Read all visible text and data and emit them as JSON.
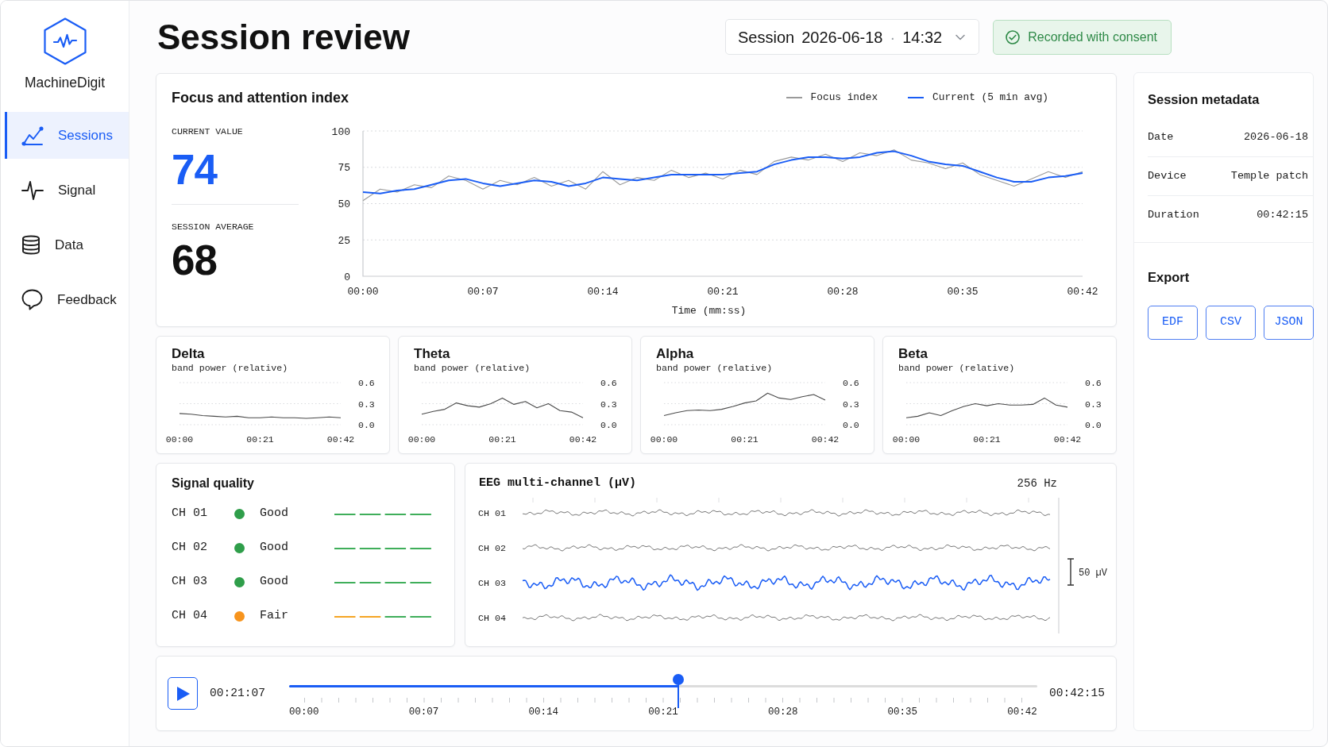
{
  "sidebar": {
    "brand": "MachineDigit",
    "items": [
      {
        "label": "Sessions",
        "selected": true
      },
      {
        "label": "Signal",
        "selected": false
      },
      {
        "label": "Data",
        "selected": false
      },
      {
        "label": "Feedback",
        "selected": false
      }
    ]
  },
  "header": {
    "title": "Session review",
    "session_picker": {
      "label": "Session",
      "date": "2026-06-18",
      "separator": "·",
      "time": "14:32"
    },
    "consent_badge": "Recorded with consent"
  },
  "focus": {
    "title": "Focus and attention index",
    "stats": [
      {
        "kind": "current",
        "label": "CURRENT VALUE",
        "value": "74"
      },
      {
        "kind": "average",
        "label": "SESSION AVERAGE",
        "value": "68"
      }
    ],
    "chart_data": {
      "type": "line",
      "xlabel": "Time (mm:ss)",
      "grid": true,
      "x": [
        0,
        1,
        2,
        3,
        4,
        5,
        6,
        7,
        8,
        9,
        10,
        11,
        12,
        13,
        14,
        15,
        16,
        17,
        18,
        19,
        20,
        21,
        22,
        23,
        24,
        25,
        26,
        27,
        28,
        29,
        30,
        31,
        32,
        33,
        34,
        35,
        36,
        37,
        38,
        39,
        40,
        41,
        42
      ],
      "xlim": [
        0,
        42
      ],
      "ylim": [
        0,
        100
      ],
      "xticks": [
        {
          "value": 0,
          "label": "00:00"
        },
        {
          "value": 7,
          "label": "00:07"
        },
        {
          "value": 14,
          "label": "00:14"
        },
        {
          "value": 21,
          "label": "00:21"
        },
        {
          "value": 28,
          "label": "00:28"
        },
        {
          "value": 35,
          "label": "00:35"
        },
        {
          "value": 42,
          "label": "00:42"
        }
      ],
      "yticks": [
        0,
        25,
        50,
        75,
        100
      ],
      "series": [
        {
          "name": "Focus index",
          "color": "#9a9a9a",
          "values": [
            52,
            60,
            58,
            63,
            61,
            69,
            66,
            60,
            66,
            63,
            68,
            62,
            66,
            60,
            72,
            63,
            68,
            66,
            73,
            68,
            71,
            67,
            73,
            70,
            79,
            82,
            80,
            84,
            79,
            85,
            83,
            87,
            80,
            78,
            74,
            78,
            70,
            66,
            62,
            67,
            72,
            68,
            72
          ]
        },
        {
          "name": "Current (5 min avg)",
          "color": "#1a5df5",
          "values": [
            58,
            57,
            59,
            60,
            63,
            66,
            67,
            64,
            62,
            64,
            66,
            65,
            62,
            64,
            68,
            67,
            66,
            68,
            70,
            70,
            70,
            70,
            71,
            72,
            77,
            80,
            82,
            82,
            81,
            82,
            85,
            86,
            83,
            79,
            77,
            76,
            72,
            68,
            65,
            65,
            68,
            69,
            71
          ]
        }
      ]
    }
  },
  "bands": [
    {
      "title": "Delta",
      "subtitle": "band power (relative)",
      "chart_data": {
        "type": "line",
        "grid": true,
        "x": [
          0,
          3,
          6,
          9,
          12,
          15,
          18,
          21,
          24,
          27,
          30,
          33,
          36,
          39,
          42
        ],
        "xlim": [
          0,
          42
        ],
        "ylim": [
          0,
          0.6
        ],
        "xticks": [
          {
            "value": 0,
            "label": "00:00"
          },
          {
            "value": 21,
            "label": "00:21"
          },
          {
            "value": 42,
            "label": "00:42"
          }
        ],
        "yticks": [
          {
            "value": 0,
            "label": "0.0"
          },
          {
            "value": 0.3,
            "label": "0.3"
          },
          {
            "value": 0.6,
            "label": "0.6"
          }
        ],
        "series": [
          {
            "values": [
              0.16,
              0.15,
              0.13,
              0.12,
              0.11,
              0.12,
              0.1,
              0.1,
              0.11,
              0.1,
              0.1,
              0.09,
              0.1,
              0.11,
              0.1
            ]
          }
        ]
      }
    },
    {
      "title": "Theta",
      "subtitle": "band power (relative)",
      "chart_data": {
        "type": "line",
        "grid": true,
        "x": [
          0,
          3,
          6,
          9,
          12,
          15,
          18,
          21,
          24,
          27,
          30,
          33,
          36,
          39,
          42
        ],
        "xlim": [
          0,
          42
        ],
        "ylim": [
          0,
          0.6
        ],
        "xticks": [
          {
            "value": 0,
            "label": "00:00"
          },
          {
            "value": 21,
            "label": "00:21"
          },
          {
            "value": 42,
            "label": "00:42"
          }
        ],
        "yticks": [
          {
            "value": 0,
            "label": "0.0"
          },
          {
            "value": 0.3,
            "label": "0.3"
          },
          {
            "value": 0.6,
            "label": "0.6"
          }
        ],
        "series": [
          {
            "values": [
              0.15,
              0.19,
              0.22,
              0.31,
              0.27,
              0.25,
              0.3,
              0.38,
              0.29,
              0.33,
              0.24,
              0.3,
              0.2,
              0.18,
              0.1
            ]
          }
        ]
      }
    },
    {
      "title": "Alpha",
      "subtitle": "band power (relative)",
      "chart_data": {
        "type": "line",
        "grid": true,
        "x": [
          0,
          3,
          6,
          9,
          12,
          15,
          18,
          21,
          24,
          27,
          30,
          33,
          36,
          39,
          42
        ],
        "xlim": [
          0,
          42
        ],
        "ylim": [
          0,
          0.6
        ],
        "xticks": [
          {
            "value": 0,
            "label": "00:00"
          },
          {
            "value": 21,
            "label": "00:21"
          },
          {
            "value": 42,
            "label": "00:42"
          }
        ],
        "yticks": [
          {
            "value": 0,
            "label": "0.0"
          },
          {
            "value": 0.3,
            "label": "0.3"
          },
          {
            "value": 0.6,
            "label": "0.6"
          }
        ],
        "series": [
          {
            "values": [
              0.13,
              0.17,
              0.2,
              0.21,
              0.2,
              0.22,
              0.26,
              0.31,
              0.34,
              0.45,
              0.38,
              0.36,
              0.4,
              0.43,
              0.35
            ]
          }
        ]
      }
    },
    {
      "title": "Beta",
      "subtitle": "band power (relative)",
      "chart_data": {
        "type": "line",
        "grid": true,
        "x": [
          0,
          3,
          6,
          9,
          12,
          15,
          18,
          21,
          24,
          27,
          30,
          33,
          36,
          39,
          42
        ],
        "xlim": [
          0,
          42
        ],
        "ylim": [
          0,
          0.6
        ],
        "xticks": [
          {
            "value": 0,
            "label": "00:00"
          },
          {
            "value": 21,
            "label": "00:21"
          },
          {
            "value": 42,
            "label": "00:42"
          }
        ],
        "yticks": [
          {
            "value": 0,
            "label": "0.0"
          },
          {
            "value": 0.3,
            "label": "0.3"
          },
          {
            "value": 0.6,
            "label": "0.6"
          }
        ],
        "series": [
          {
            "values": [
              0.1,
              0.12,
              0.17,
              0.13,
              0.2,
              0.26,
              0.3,
              0.27,
              0.3,
              0.28,
              0.28,
              0.29,
              0.38,
              0.28,
              0.25
            ]
          }
        ]
      }
    }
  ],
  "signal_quality": {
    "title": "Signal quality",
    "channels": [
      {
        "channel": "CH 01",
        "color": "#2f9e4a",
        "status": "Good",
        "segments": [
          {
            "color": "#3fae5a"
          },
          {
            "color": "#3fae5a"
          },
          {
            "color": "#3fae5a"
          },
          {
            "color": "#3fae5a"
          }
        ]
      },
      {
        "channel": "CH 02",
        "color": "#2f9e4a",
        "status": "Good",
        "segments": [
          {
            "color": "#3fae5a"
          },
          {
            "color": "#3fae5a"
          },
          {
            "color": "#3fae5a"
          },
          {
            "color": "#3fae5a"
          }
        ]
      },
      {
        "channel": "CH 03",
        "color": "#2f9e4a",
        "status": "Good",
        "segments": [
          {
            "color": "#3fae5a"
          },
          {
            "color": "#3fae5a"
          },
          {
            "color": "#3fae5a"
          },
          {
            "color": "#3fae5a"
          }
        ]
      },
      {
        "channel": "CH 04",
        "color": "#f7941d",
        "status": "Fair",
        "segments": [
          {
            "color": "#f5a524"
          },
          {
            "color": "#f5a524"
          },
          {
            "color": "#3fae5a"
          },
          {
            "color": "#3fae5a"
          }
        ]
      }
    ]
  },
  "eeg": {
    "title": "EEG multi-channel (µV)",
    "rate": "256 Hz",
    "scale": "50 µV",
    "channels": [
      {
        "label": "CH 01",
        "selected": false
      },
      {
        "label": "CH 02",
        "selected": false
      },
      {
        "label": "CH 03",
        "selected": true
      },
      {
        "label": "CH 04",
        "selected": false
      }
    ]
  },
  "player": {
    "current": "00:21:07",
    "level": 0.52,
    "total": "00:42:15",
    "ticks": [
      "00:00",
      "00:07",
      "00:14",
      "00:21",
      "00:28",
      "00:35",
      "00:42"
    ]
  },
  "metadata": {
    "title": "Session metadata",
    "rows": [
      {
        "label": "Date",
        "value": "2026-06-18"
      },
      {
        "label": "Device",
        "value": "Temple patch"
      },
      {
        "label": "Duration",
        "value": "00:42:15"
      }
    ]
  },
  "export": {
    "title": "Export",
    "buttons": [
      "EDF",
      "CSV",
      "JSON"
    ]
  }
}
